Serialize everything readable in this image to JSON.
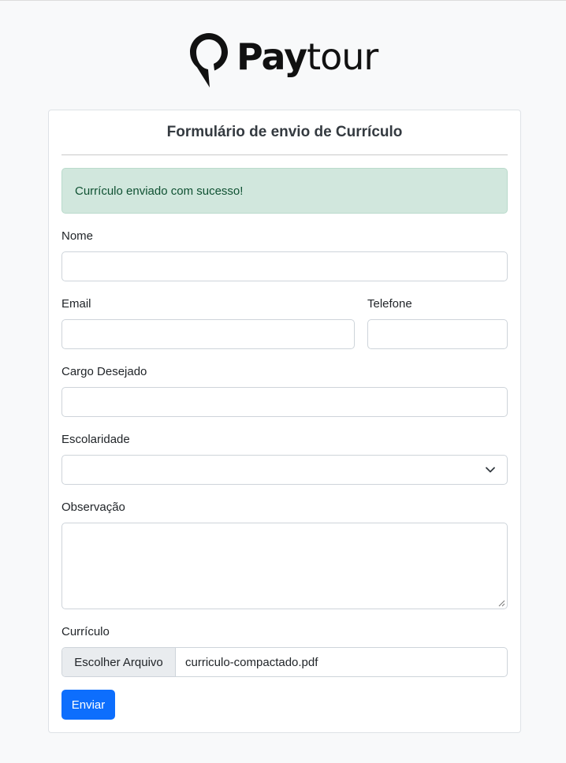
{
  "brand": {
    "name_bold": "Pay",
    "name_light": "tour"
  },
  "form": {
    "title": "Formulário de envio de Currículo",
    "success_message": "Currículo enviado com sucesso!",
    "fields": {
      "nome": {
        "label": "Nome",
        "value": ""
      },
      "email": {
        "label": "Email",
        "value": ""
      },
      "telefone": {
        "label": "Telefone",
        "value": ""
      },
      "cargo": {
        "label": "Cargo Desejado",
        "value": ""
      },
      "escolaridade": {
        "label": "Escolaridade",
        "value": ""
      },
      "observacao": {
        "label": "Observação",
        "value": ""
      },
      "curriculo": {
        "label": "Currículo",
        "button_label": "Escolher Arquivo",
        "file_name": "curriculo-compactado.pdf"
      }
    },
    "submit_label": "Enviar"
  },
  "colors": {
    "primary": "#0d6efd",
    "success_bg": "#d1e7dd",
    "success_text": "#0f5132",
    "page_bg": "#f8f9fa"
  },
  "icons": {
    "logo": "map-pin-logo-icon",
    "select": "chevron-down-icon"
  }
}
